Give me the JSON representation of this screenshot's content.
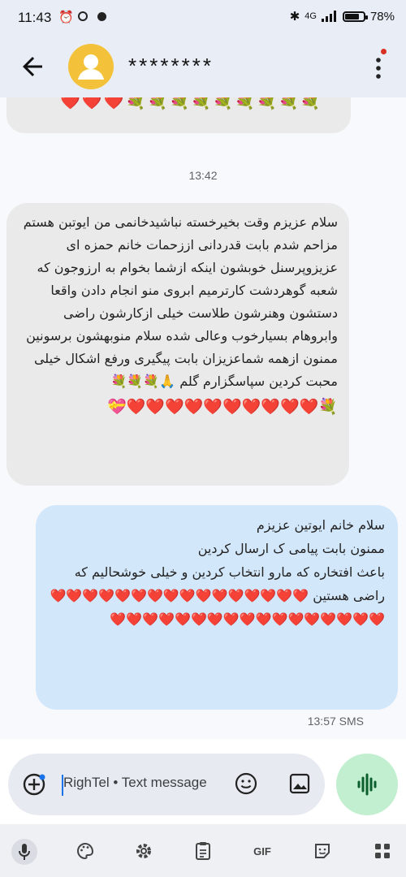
{
  "status_bar": {
    "time": "11:43",
    "network": "4G",
    "battery": "78%",
    "battery_level": 0.78
  },
  "header": {
    "contact_name": "********"
  },
  "conversation": {
    "prev_message_emojis": "💐💐💐💐💐💐💐💐💐❤️❤️❤️",
    "separator_time": "13:42",
    "incoming_message": {
      "text": "سلام عزیزم وقت بخیرخسته نباشیدخانمی من ایوتبن هستم مزاحم شدم بابت قدردانی اززحمات خانم حمزه ای عزیزوپرسنل خوبشون اینکه ازشما بخوام به ارزوجون که شعبه گوهردشت کارترمیم ابروی منو انجام دادن واقعا دستشون وهنرشون طلاست خیلی ازکارشون راضی وابروهام بسیارخوب وعالی شده سلام منوبهشون برسونین ممنون ازهمه شماعزیزان بابت پیگیری ورفع اشکال خیلی محبت کردین سپاسگزارم گلم 🙏💐💐💐",
      "emoji_line": "💐❤️❤️❤️❤️❤️❤️❤️❤️❤️❤️💝"
    },
    "outgoing_message": {
      "text": "سلام خانم ایوتین عزیزم\nممنون بابت پیامی ک ارسال کردین\nباعث افتخاره که مارو انتخاب کردین و خیلی خوشحالیم که راضی هستین ❤️❤️❤️❤️❤️❤️❤️❤️❤️❤️❤️❤️❤️❤️❤️❤️❤️❤️❤️❤️❤️❤️❤️❤️❤️❤️❤️❤️❤️❤️❤️❤️❤️"
    },
    "sent_meta": "13:57 SMS"
  },
  "composer": {
    "placeholder": "RighTel • Text message"
  },
  "keyboard_toolbar": {
    "gif_label": "GIF"
  },
  "colors": {
    "header_bg": "#e9eef6",
    "incoming_bubble": "#eaeaea",
    "outgoing_bubble": "#d3e7fb",
    "voice_button": "#c2efd0",
    "avatar": "#f4c23a"
  }
}
